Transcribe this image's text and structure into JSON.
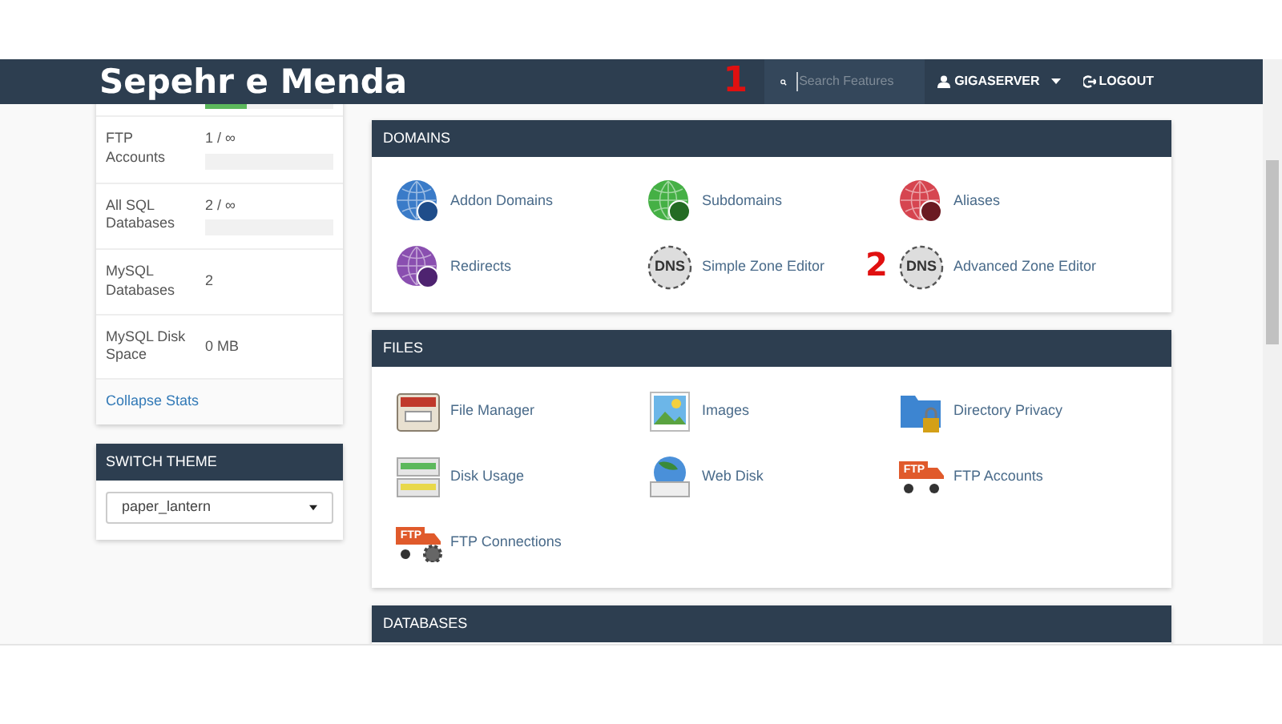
{
  "navbar": {
    "brand": "Sepehr e Menda",
    "search": {
      "placeholder": "Search Features"
    },
    "user": "GIGASERVER",
    "logout": "LOGOUT"
  },
  "annotations": [
    {
      "text": "1"
    },
    {
      "text": "2"
    }
  ],
  "stats": [
    {
      "kind": "bar-only",
      "level": 0.33
    },
    {
      "kind": "bar",
      "label": "FTP Accounts",
      "value": "1 / ∞"
    },
    {
      "kind": "bar",
      "label": "All SQL Databases",
      "value": "2 / ∞"
    },
    {
      "kind": "plain",
      "label": "MySQL Databases",
      "value": "2"
    },
    {
      "kind": "plain",
      "label": "MySQL Disk Space",
      "value": "0 MB"
    }
  ],
  "collapse_link": "Collapse Stats",
  "switch_theme": {
    "title": "SWITCH THEME",
    "value": "paper_lantern"
  },
  "sections": [
    {
      "title": "DOMAINS",
      "items": [
        {
          "label": "Addon Domains"
        },
        {
          "label": "Subdomains"
        },
        {
          "label": "Aliases"
        },
        {
          "label": "Redirects"
        },
        {
          "label": "Simple Zone Editor",
          "icon_text": "DNS"
        },
        {
          "label": "Advanced Zone Editor",
          "icon_text": "DNS"
        }
      ]
    },
    {
      "title": "FILES",
      "items": [
        {
          "label": "File Manager"
        },
        {
          "label": "Images"
        },
        {
          "label": "Directory Privacy"
        },
        {
          "label": "Disk Usage"
        },
        {
          "label": "Web Disk"
        },
        {
          "label": "FTP Accounts",
          "icon_text": "FTP"
        },
        {
          "label": "FTP Connections",
          "icon_text": "FTP"
        }
      ]
    },
    {
      "title": "DATABASES"
    }
  ]
}
